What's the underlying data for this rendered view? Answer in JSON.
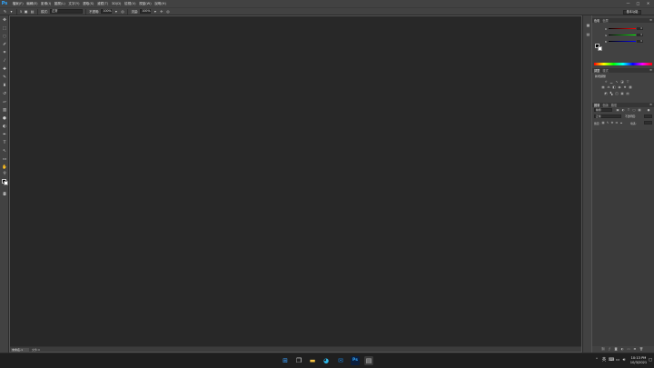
{
  "menubar": {
    "logo": "Ps",
    "items": [
      "檔案(F)",
      "編輯(E)",
      "影像(I)",
      "圖層(L)",
      "文字(Y)",
      "選取(S)",
      "濾鏡(T)",
      "3D(D)",
      "檢視(V)",
      "視窗(W)",
      "說明(H)"
    ],
    "window_controls": [
      "—",
      "□",
      "✕"
    ]
  },
  "options_bar": {
    "brush_size": "5",
    "mode_label": "模式:",
    "mode_value": "正常",
    "opacity_label": "不透明:",
    "opacity_value": "100%",
    "flow_label": "流量:",
    "flow_value": "100%",
    "workspace": "基本功能"
  },
  "panels": {
    "color": {
      "tabs": [
        "色彩",
        "色票"
      ],
      "slider_labels": [
        "R",
        "G",
        "B"
      ],
      "values": [
        "0",
        "0",
        "0"
      ]
    },
    "adjustments": {
      "tabs": [
        "調整",
        "樣式"
      ],
      "title": "新增調整"
    },
    "layers": {
      "tabs": [
        "圖層",
        "色版",
        "路徑"
      ],
      "kind_label": "種類",
      "blend_mode": "正常",
      "opacity_label": "不透明度:",
      "lock_label": "鎖定:",
      "fill_label": "填滿:"
    }
  },
  "statusbar": {
    "doc_tab": "未命名-1",
    "doc_info": "文件:0"
  },
  "taskbar": {
    "time": "10:13 PM",
    "date": "10/3/2021",
    "lang": "英"
  }
}
